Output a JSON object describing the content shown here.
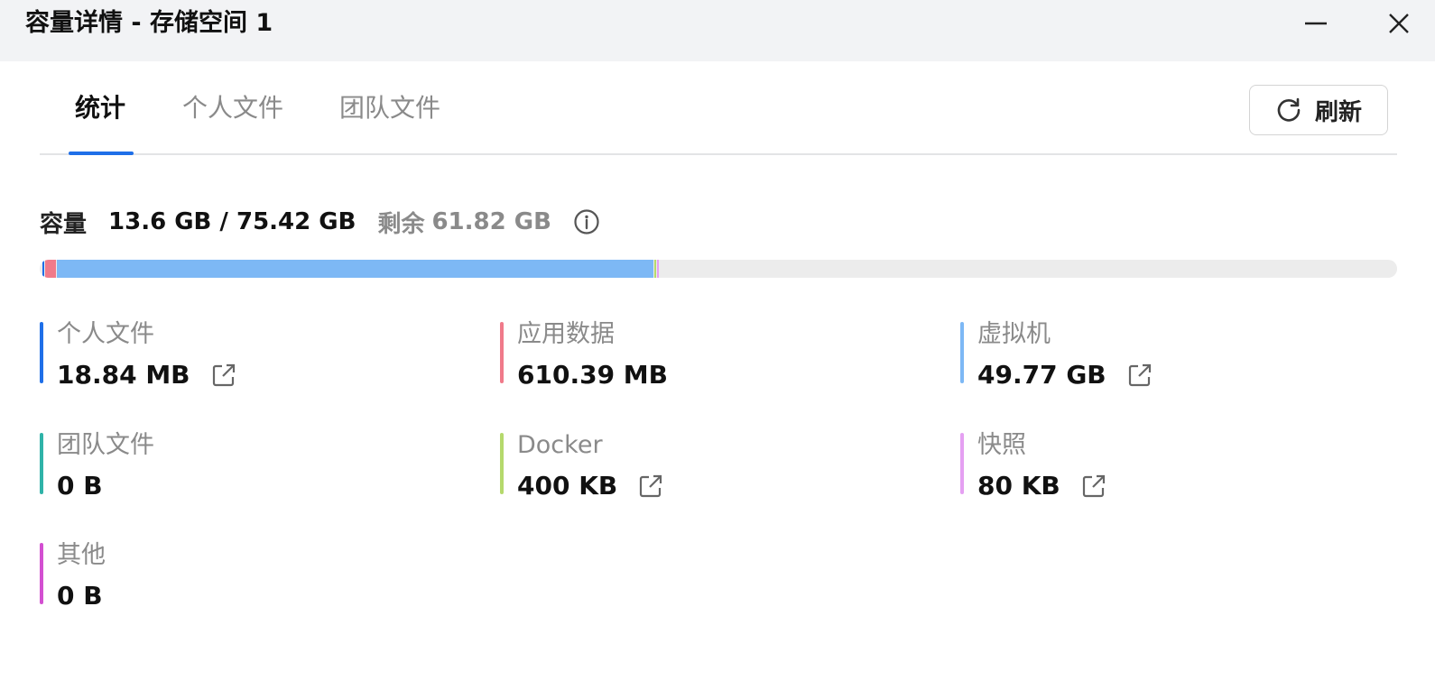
{
  "window": {
    "title": "容量详情 - 存储空间 1",
    "minimize_icon": "minimize-icon",
    "close_icon": "close-icon"
  },
  "tabs": [
    {
      "label": "统计",
      "active": true
    },
    {
      "label": "个人文件",
      "active": false
    },
    {
      "label": "团队文件",
      "active": false
    }
  ],
  "refresh": {
    "label": "刷新",
    "icon": "refresh-icon"
  },
  "capacity": {
    "label": "容量",
    "used_total": "13.6 GB / 75.42 GB",
    "remaining_label": "剩余",
    "remaining_value": "61.82 GB",
    "info_icon": "info-icon",
    "bar_track_color": "#ececec"
  },
  "categories": [
    {
      "name": "个人文件",
      "value": "18.84 MB",
      "color": "#1f6fe8",
      "link": true
    },
    {
      "name": "应用数据",
      "value": "610.39 MB",
      "color": "#f07a8a",
      "link": false
    },
    {
      "name": "虚拟机",
      "value": "49.77 GB",
      "color": "#7db8f5",
      "link": true
    },
    {
      "name": "团队文件",
      "value": "0 B",
      "color": "#2fb3a8",
      "link": false
    },
    {
      "name": "Docker",
      "value": "400 KB",
      "color": "#b5d96c",
      "link": true
    },
    {
      "name": "快照",
      "value": "80 KB",
      "color": "#e5a0f2",
      "link": true
    },
    {
      "name": "其他",
      "value": "0 B",
      "color": "#d34fd1",
      "link": false
    }
  ],
  "usage_bar": {
    "total_gb": 75.42,
    "segments": [
      {
        "category": "个人文件",
        "fraction": 0.0015
      },
      {
        "category": "应用数据",
        "fraction": 0.0079
      },
      {
        "category": "虚拟机",
        "fraction": 0.4395
      },
      {
        "category": "Docker",
        "fraction": 0.0013
      },
      {
        "category": "快照",
        "fraction": 0.0013
      }
    ]
  }
}
